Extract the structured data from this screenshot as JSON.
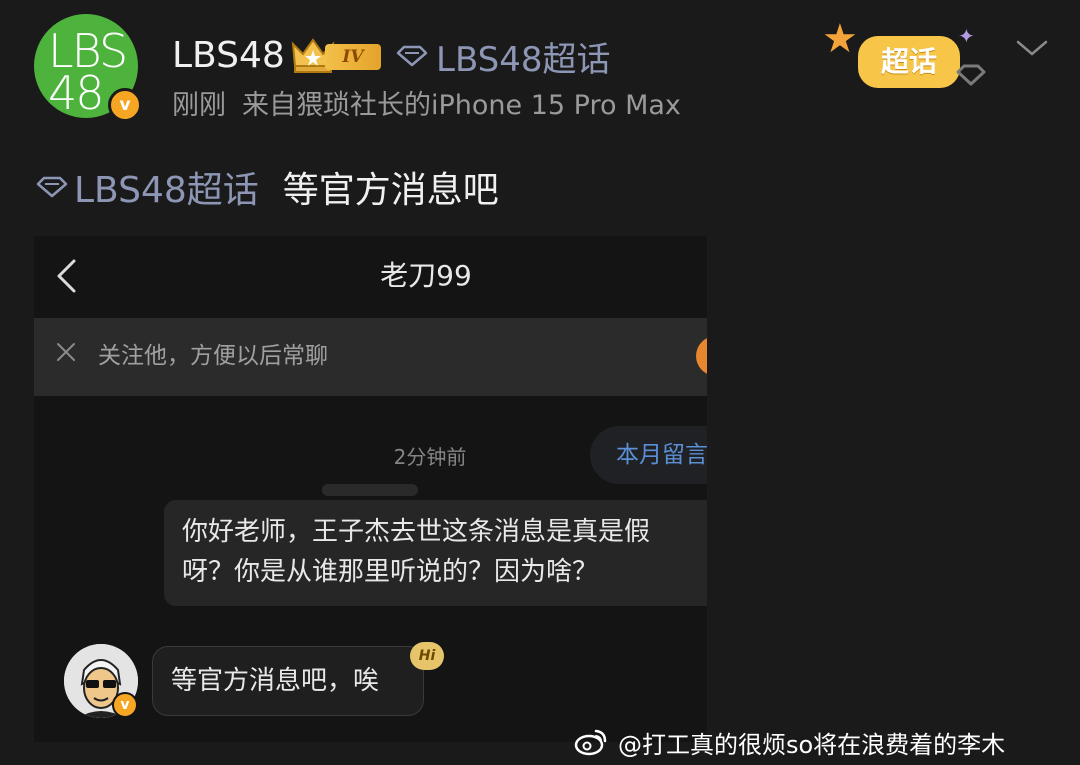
{
  "post": {
    "avatar_line1": "LBS",
    "avatar_line2": "48",
    "username": "LBS48",
    "level_badge": "IV",
    "header_topic": "LBS48超话",
    "meta_time": "刚刚",
    "meta_source": "来自猥琐社长的iPhone 15 Pro Max",
    "super_topic_badge": "超话",
    "topic_link": "LBS48超话",
    "body_text": "等官方消息吧"
  },
  "chat": {
    "title": "老刀99",
    "follow_tip": "关注他，方便以后常聊",
    "timestamp": "2分钟前",
    "monthly_tab": "本月留言",
    "outgoing_message": "你好老师，王子杰去世这条消息是真是假呀？你是从谁那里听说的？因为啥？",
    "incoming_message": "等官方消息吧，唉",
    "hi_badge": "Hi"
  },
  "watermark": {
    "text": "@打工真的很烦so将在浪费着的李木"
  },
  "colors": {
    "background": "#1a1a1a",
    "avatar_green": "#4db33d",
    "verified_orange": "#f6a623",
    "topic_link": "#8d96b5",
    "monthly_tab_blue": "#5b8fd6"
  },
  "icons": [
    "verified-v-icon",
    "crown-icon",
    "diamond-topic-icon",
    "chevron-down-icon",
    "back-arrow-icon",
    "close-icon",
    "weibo-logo-icon"
  ]
}
